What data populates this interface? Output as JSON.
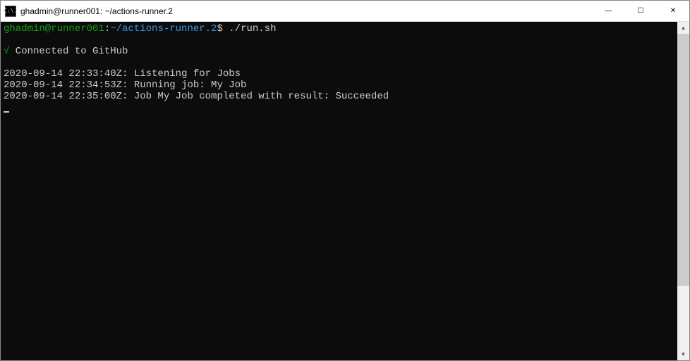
{
  "window": {
    "title": "ghadmin@runner001: ~/actions-runner.2",
    "icon_text": "C:\\."
  },
  "controls": {
    "minimize": "—",
    "maximize": "☐",
    "close": "✕"
  },
  "terminal": {
    "prompt_user_host": "ghadmin@runner001",
    "prompt_sep": ":",
    "prompt_path": "~/actions-runner.2",
    "prompt_symbol": "$",
    "command": "./run.sh",
    "check": "√",
    "connected_msg": " Connected to GitHub",
    "log1": "2020-09-14 22:33:40Z: Listening for Jobs",
    "log2": "2020-09-14 22:34:53Z: Running job: My Job",
    "log3": "2020-09-14 22:35:00Z: Job My Job completed with result: Succeeded"
  },
  "scrollbar": {
    "up": "▲",
    "down": "▼"
  }
}
